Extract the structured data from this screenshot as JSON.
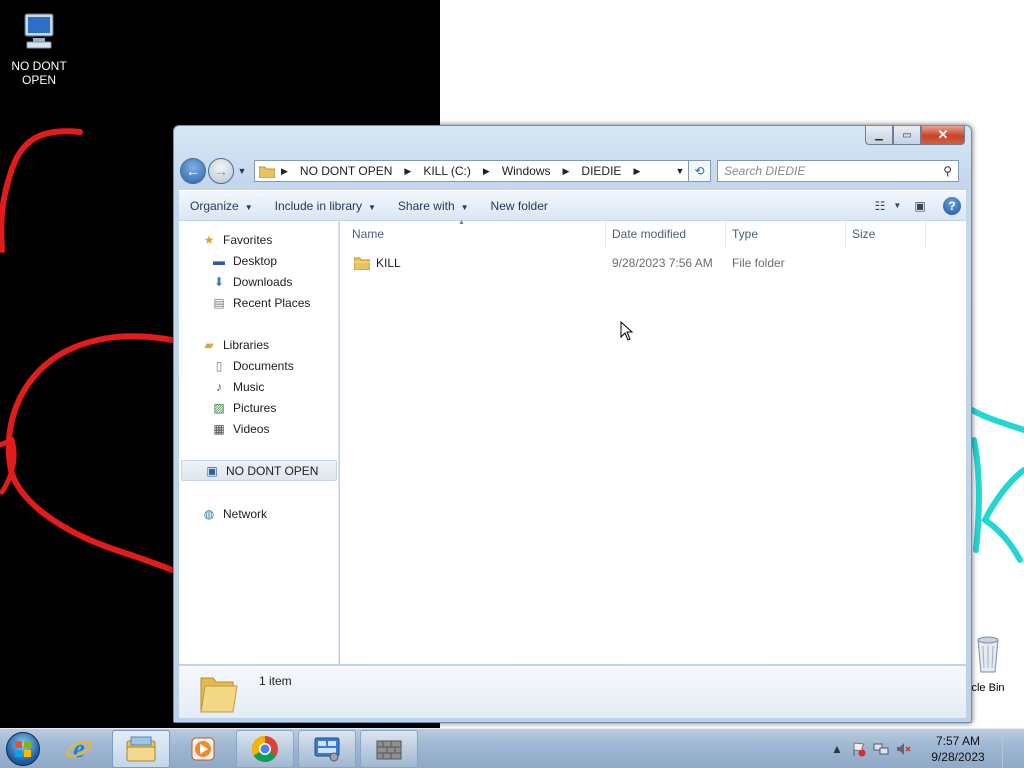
{
  "desktop": {
    "icons": [
      {
        "label": "NO DONT OPEN",
        "icon": "computer-icon"
      },
      {
        "label": "cle Bin",
        "icon": "recycle-bin-icon"
      }
    ]
  },
  "window": {
    "address": {
      "crumbs": [
        "NO DONT OPEN",
        "KILL (C:)",
        "Windows",
        "DIEDIE"
      ]
    },
    "search_placeholder": "Search DIEDIE",
    "toolbar": {
      "organize": "Organize",
      "include_in_library": "Include in library",
      "share_with": "Share with",
      "new_folder": "New folder"
    },
    "nav": {
      "favorites": {
        "label": "Favorites",
        "items": [
          "Desktop",
          "Downloads",
          "Recent Places"
        ]
      },
      "libraries": {
        "label": "Libraries",
        "items": [
          "Documents",
          "Music",
          "Pictures",
          "Videos"
        ]
      },
      "computer": {
        "label": "NO DONT OPEN"
      },
      "network": {
        "label": "Network"
      }
    },
    "columns": [
      "Name",
      "Date modified",
      "Type",
      "Size"
    ],
    "rows": [
      {
        "name": "KILL",
        "date": "9/28/2023 7:56 AM",
        "type": "File folder",
        "size": ""
      }
    ],
    "details": {
      "count": "1 item"
    }
  },
  "taskbar": {
    "items": [
      "start-orb",
      "internet-explorer-icon",
      "windows-explorer-icon",
      "media-player-icon",
      "chrome-icon",
      "control-panel-icon",
      "firewall-icon"
    ],
    "clock": {
      "time": "7:57 AM",
      "date": "9/28/2023"
    }
  }
}
